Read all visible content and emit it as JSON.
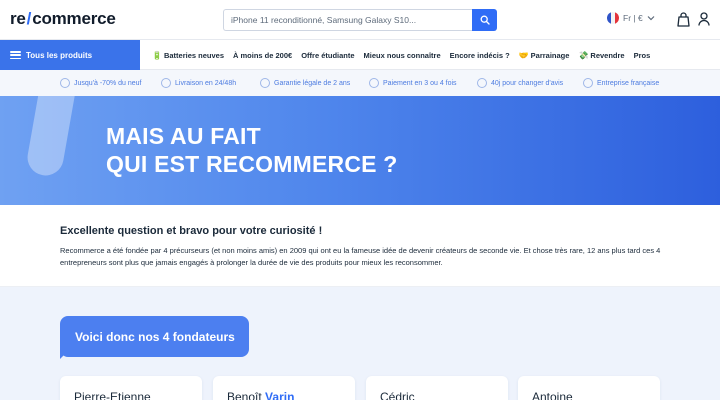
{
  "header": {
    "logo_prefix": "re",
    "logo_slash": "/",
    "logo_suffix": "commerce",
    "search_placeholder": "iPhone 11 reconditionné, Samsung Galaxy S10...",
    "lang_label": "Fr | €",
    "icons": [
      "search-icon",
      "chevron-down-icon",
      "shopping-bag-icon",
      "user-icon"
    ]
  },
  "nav": {
    "all_products": "Tous les produits",
    "items": [
      {
        "emoji": "🔋",
        "label": "Batteries neuves"
      },
      {
        "emoji": "",
        "label": "À moins de 200€"
      },
      {
        "emoji": "",
        "label": "Offre étudiante"
      },
      {
        "emoji": "",
        "label": "Mieux nous connaître"
      },
      {
        "emoji": "",
        "label": "Encore indécis ?"
      },
      {
        "emoji": "🤝",
        "label": "Parrainage"
      },
      {
        "emoji": "💸",
        "label": "Revendre"
      },
      {
        "emoji": "",
        "label": "Pros"
      }
    ]
  },
  "benefits": [
    "Jusqu'à -70% du neuf",
    "Livraison en 24/48h",
    "Garantie légale de 2 ans",
    "Paiement en 3 ou 4 fois",
    "40j pour changer d'avis",
    "Entreprise française"
  ],
  "hero": {
    "line1": "MAIS AU FAIT",
    "line2": "QUI EST RECOMMERCE ?"
  },
  "intro": {
    "title": "Excellente question et bravo pour votre curiosité !",
    "text": "Recommerce a été fondée par 4 précurseurs (et non moins amis) en 2009 qui ont eu la fameuse idée de devenir créateurs de seconde vie. Et chose très rare, 12 ans plus tard ces 4 entrepreneurs sont plus que jamais engagés à prolonger la durée de vie des produits pour mieux les reconsommer."
  },
  "founders": {
    "heading": "Voici donc nos 4 fondateurs",
    "cards": [
      {
        "first": "Pierre-Etienne",
        "last": ""
      },
      {
        "first": "Benoît",
        "last": "Varin"
      },
      {
        "first": "Cédric",
        "last": ""
      },
      {
        "first": "Antoine",
        "last": ""
      }
    ]
  },
  "colors": {
    "accent": "#2f6cf6",
    "nav_blue": "#3a73ea",
    "benefit_text": "#4c7be0",
    "founders_bg": "#eef3fc"
  }
}
